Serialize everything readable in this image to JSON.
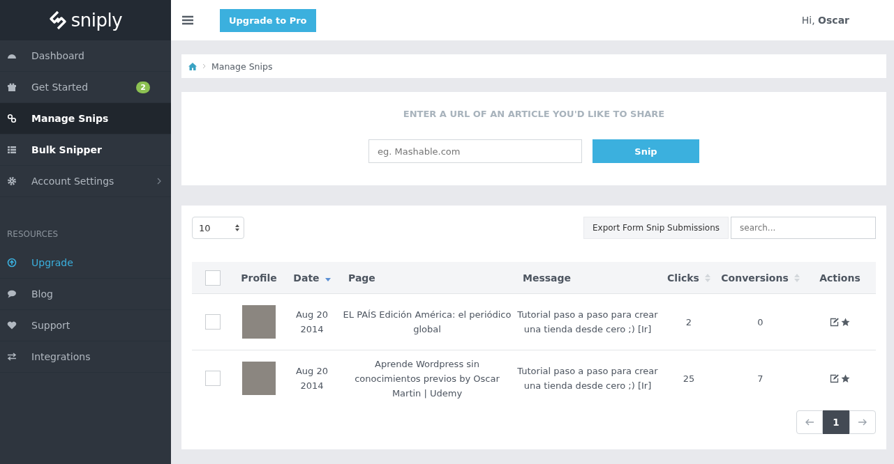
{
  "logo": {
    "text": "sniply"
  },
  "sidebar": {
    "items": [
      {
        "label": "Dashboard",
        "selected": false,
        "bold": false,
        "accent": false
      },
      {
        "label": "Get Started",
        "badge": "2",
        "selected": false,
        "bold": false,
        "accent": false
      },
      {
        "label": "Manage Snips",
        "selected": true,
        "bold": true,
        "accent": false
      },
      {
        "label": "Bulk Snipper",
        "selected": false,
        "bold": true,
        "accent": false
      },
      {
        "label": "Account Settings",
        "selected": false,
        "bold": false,
        "accent": false,
        "has_submenu": true
      }
    ],
    "section_title": "RESOURCES",
    "resource_items": [
      {
        "label": "Upgrade",
        "selected": false,
        "bold": false,
        "accent": true
      },
      {
        "label": "Blog",
        "selected": false,
        "bold": false,
        "accent": false
      },
      {
        "label": "Support",
        "selected": false,
        "bold": false,
        "accent": false
      },
      {
        "label": "Integrations",
        "selected": false,
        "bold": false,
        "accent": false
      }
    ]
  },
  "header": {
    "upgrade_button": "Upgrade to Pro",
    "greeting": "Hi, **Oscar**"
  },
  "breadcrumb": {
    "current": "Manage Snips"
  },
  "snip_form": {
    "heading": "ENTER A URL OF AN ARTICLE YOU'D LIKE TO SHARE",
    "placeholder": "eg. Mashable.com",
    "button": "Snip"
  },
  "table_controls": {
    "page_size": "10",
    "export_button": "Export Form Snip Submissions",
    "search_placeholder": "search..."
  },
  "table": {
    "columns": [
      {
        "kind": "checkbox",
        "checked": false
      },
      {
        "label": "Profile",
        "kind": "text"
      },
      {
        "label": "Date",
        "kind": "text",
        "sortable": true,
        "sorted": true
      },
      {
        "label": "Page",
        "kind": "text"
      },
      {
        "label": "Message",
        "kind": "text"
      },
      {
        "label": "Clicks",
        "kind": "text",
        "sortable": true,
        "sorted": false
      },
      {
        "label": "Conversions",
        "kind": "text",
        "sortable": true,
        "sorted": false
      },
      {
        "label": "Actions",
        "kind": "text"
      }
    ],
    "rows": [
      {
        "checked": false,
        "date": "Aug 20 2014",
        "page": "EL PAÍS Edición América: el periódico global",
        "message": "Tutorial paso a paso para crear una tienda desde cero ;) [Ir]",
        "clicks": "2",
        "conversions": "0"
      },
      {
        "checked": false,
        "date": "Aug 20 2014",
        "page": "Aprende Wordpress sin conocimientos previos by Oscar Martin | Udemy",
        "message": "Tutorial paso a paso para crear una tienda desde cero ;) [Ir]",
        "clicks": "25",
        "conversions": "7"
      }
    ]
  },
  "pagination": {
    "pages": [
      {
        "label": "1",
        "selected": true
      }
    ]
  }
}
